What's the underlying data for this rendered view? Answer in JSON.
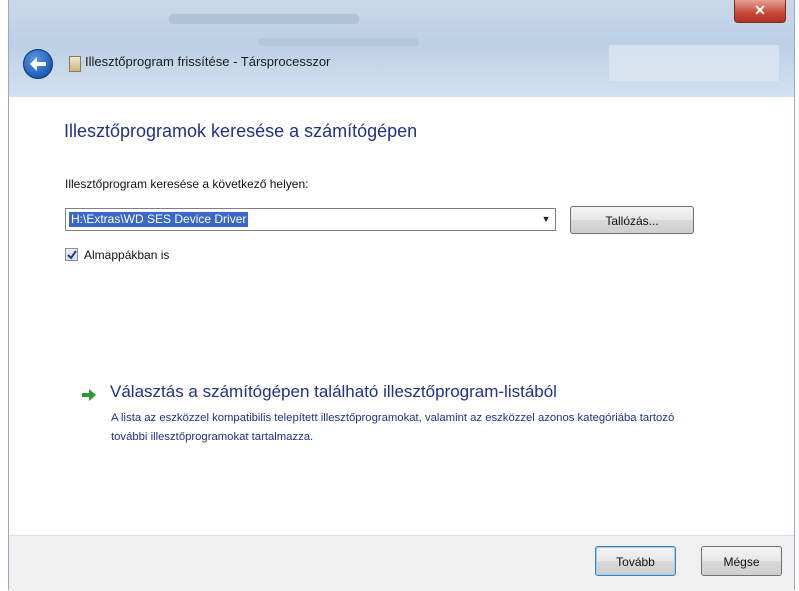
{
  "window": {
    "title": "Illesztőprogram frissítése - Társprocesszor",
    "close_glyph": "✕"
  },
  "main": {
    "heading": "Illesztőprogramok keresése a számítógépen",
    "search_label": "Illesztőprogram keresése a következő helyen:",
    "path_value": "H:\\Extras\\WD SES Device Driver",
    "browse_label": "Tallózás...",
    "subfolders_label": "Almappákban is",
    "subfolders_checked": true,
    "choose_link_title": "Választás a számítógépen található illesztőprogram-listából",
    "choose_link_desc": "A lista az eszközzel kompatibilis telepített illesztőprogramokat, valamint az eszközzel azonos kategóriába tartozó további illesztőprogramokat tartalmazza."
  },
  "footer": {
    "next_label": "Tovább",
    "cancel_label": "Mégse"
  },
  "icons": {
    "back": "back-arrow-icon",
    "dialog": "driver-update-icon",
    "link_arrow": "green-arrow-icon",
    "checkbox": "checkmark-icon",
    "dropdown": "chevron-down-icon"
  },
  "colors": {
    "heading": "#1e3287",
    "selection": "#3a68c8",
    "link_arrow": "#2e9a2e"
  }
}
